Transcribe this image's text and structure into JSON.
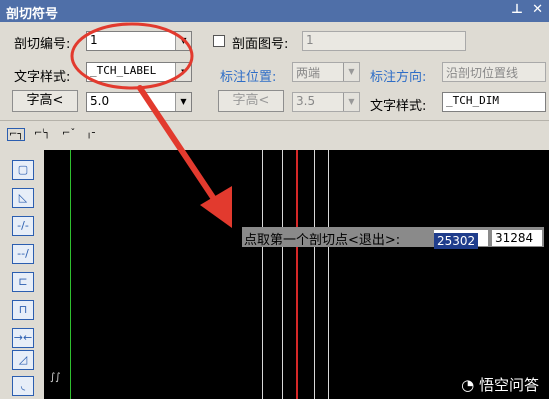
{
  "window": {
    "title": "剖切符号",
    "pin_icon": "pin-icon",
    "close_icon": "close-icon"
  },
  "row1": {
    "number_label": "剖切编号:",
    "number_value": "1",
    "section_checkbox_label": "剖面图号:",
    "section_value": "1"
  },
  "row2": {
    "text_style_label": "文字样式:",
    "text_style_value": "_TCH_LABEL",
    "position_label": "标注位置:",
    "position_value": "两端",
    "direction_label": "标注方向:",
    "direction_value": "沿剖切位置线"
  },
  "row3": {
    "char_height_button": "字高<",
    "char_height_value": "5.0",
    "char_height_button2": "字高<",
    "char_height_value2": "3.5",
    "text_style_label2": "文字样式:",
    "text_style_value2": "_TCH_DIM"
  },
  "prompt": {
    "text": "点取第一个剖切点<退出>:",
    "x_value": "25302",
    "y_value": "31284"
  },
  "watermark": "悟空问答",
  "colors": {
    "title_bg": "#4f6fa8",
    "panel_bg": "#dedbd3",
    "annotation_red": "#e23a2e",
    "blue_label": "#2f6ec7"
  }
}
